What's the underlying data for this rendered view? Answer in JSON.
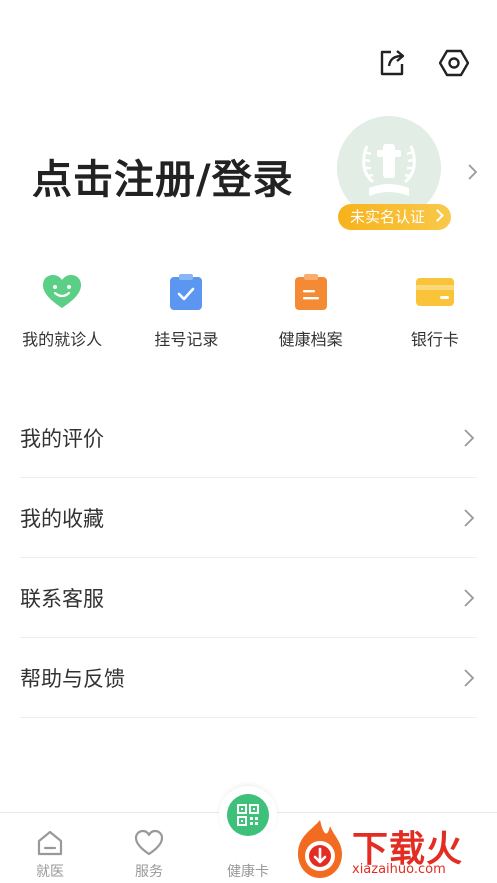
{
  "header": {
    "share_icon": "share-icon",
    "settings_icon": "settings-icon"
  },
  "profile": {
    "login_text": "点击注册/登录",
    "verify_badge": "未实名认证",
    "avatar_icon": "hospital-emblem-avatar"
  },
  "shortcuts": [
    {
      "label": "我的就诊人",
      "icon": "heart-smile-icon",
      "color": "#5ccf86"
    },
    {
      "label": "挂号记录",
      "icon": "clipboard-check-icon",
      "color": "#5b96f0"
    },
    {
      "label": "健康档案",
      "icon": "health-file-icon",
      "color": "#f58a34"
    },
    {
      "label": "银行卡",
      "icon": "bank-card-icon",
      "color": "#f9c43a"
    }
  ],
  "menu": [
    {
      "label": "我的评价"
    },
    {
      "label": "我的收藏"
    },
    {
      "label": "联系客服"
    },
    {
      "label": "帮助与反馈"
    }
  ],
  "tabbar": {
    "tabs": [
      {
        "label": "就医",
        "icon": "home-icon"
      },
      {
        "label": "服务",
        "icon": "heart-icon"
      },
      {
        "label": "健康卡",
        "icon": "qr-code-icon"
      }
    ]
  },
  "watermark": {
    "text": "下载火",
    "url": "xiazaihuo.com"
  },
  "colors": {
    "accent_green": "#3cc07a",
    "badge_orange": "#f7b21a",
    "watermark_red": "#e32d23"
  }
}
